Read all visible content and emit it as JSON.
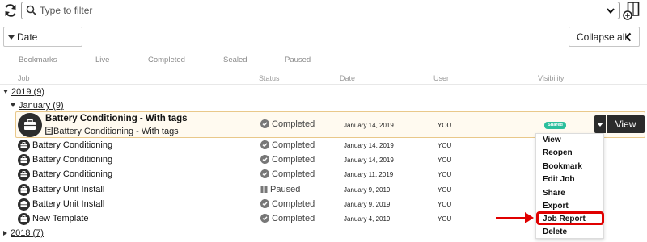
{
  "toolbar": {
    "filter_placeholder": "Type to filter",
    "refresh_icon": "refresh-icon",
    "new_icon": "new-document-icon"
  },
  "controls": {
    "date_dropdown_label": "Date",
    "collapse_label": "Collapse all"
  },
  "filter_tabs": [
    "Bookmarks",
    "Live",
    "Completed",
    "Sealed",
    "Paused"
  ],
  "columns": {
    "job": "Job",
    "status": "Status",
    "date": "Date",
    "user": "User",
    "visibility": "Visibility"
  },
  "groups": {
    "year_2019": "2019 (9)",
    "month_january": "January (9)",
    "year_2018": "2018 (7)"
  },
  "selected_job": {
    "title": "Battery Conditioning - With tags",
    "subtitle": "Battery Conditioning - With tags",
    "status": "Completed",
    "date": "January 14, 2019",
    "user": "YOU",
    "visibility": "Shared",
    "view_label": "View"
  },
  "rows": [
    {
      "name": "Battery Conditioning",
      "status": "Completed",
      "date": "January 14, 2019",
      "user": "YOU"
    },
    {
      "name": "Battery Conditioning",
      "status": "Completed",
      "date": "January 14, 2019",
      "user": "YOU"
    },
    {
      "name": "Battery Conditioning",
      "status": "Completed",
      "date": "January 11, 2019",
      "user": "YOU"
    },
    {
      "name": "Battery Unit Install",
      "status": "Paused",
      "date": "January 9, 2019",
      "user": "YOU"
    },
    {
      "name": "Battery Unit Install",
      "status": "Completed",
      "date": "January 9, 2019",
      "user": "YOU"
    },
    {
      "name": "New Template",
      "status": "Completed",
      "date": "January 4, 2019",
      "user": "YOU"
    }
  ],
  "menu": {
    "items": [
      "View",
      "Reopen",
      "Bookmark",
      "Edit Job",
      "Share",
      "Export",
      "Job Report",
      "Delete"
    ],
    "highlighted": "Job Report"
  },
  "colors": {
    "highlight": "#e00000",
    "shared_badge": "#2bbf9d",
    "selected_bg": "#fffaf0",
    "dark_button": "#2b2b2b"
  }
}
